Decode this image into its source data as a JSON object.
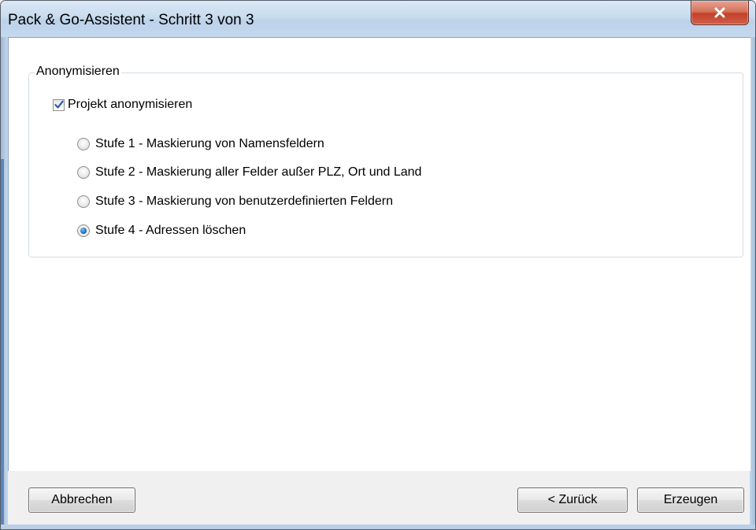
{
  "window": {
    "title": "Pack & Go-Assistent - Schritt 3 von 3"
  },
  "group": {
    "title": "Anonymisieren",
    "checkbox": {
      "label": "Projekt anonymisieren",
      "checked": true
    },
    "options": [
      {
        "label": "Stufe 1 - Maskierung von Namensfeldern",
        "selected": false
      },
      {
        "label": "Stufe 2 - Maskierung aller Felder außer PLZ, Ort und Land",
        "selected": false
      },
      {
        "label": "Stufe 3 - Maskierung von benutzerdefinierten Feldern",
        "selected": false
      },
      {
        "label": "Stufe 4 - Adressen löschen",
        "selected": true
      }
    ]
  },
  "buttons": {
    "cancel": "Abbrechen",
    "back": "< Zurück",
    "create": "Erzeugen"
  },
  "icons": {
    "close": "close-icon",
    "check": "checkmark-icon"
  },
  "colors": {
    "close_button": "#c3402a",
    "radio_selected": "#1d6fb8",
    "checkmark": "#2a5ca8"
  }
}
